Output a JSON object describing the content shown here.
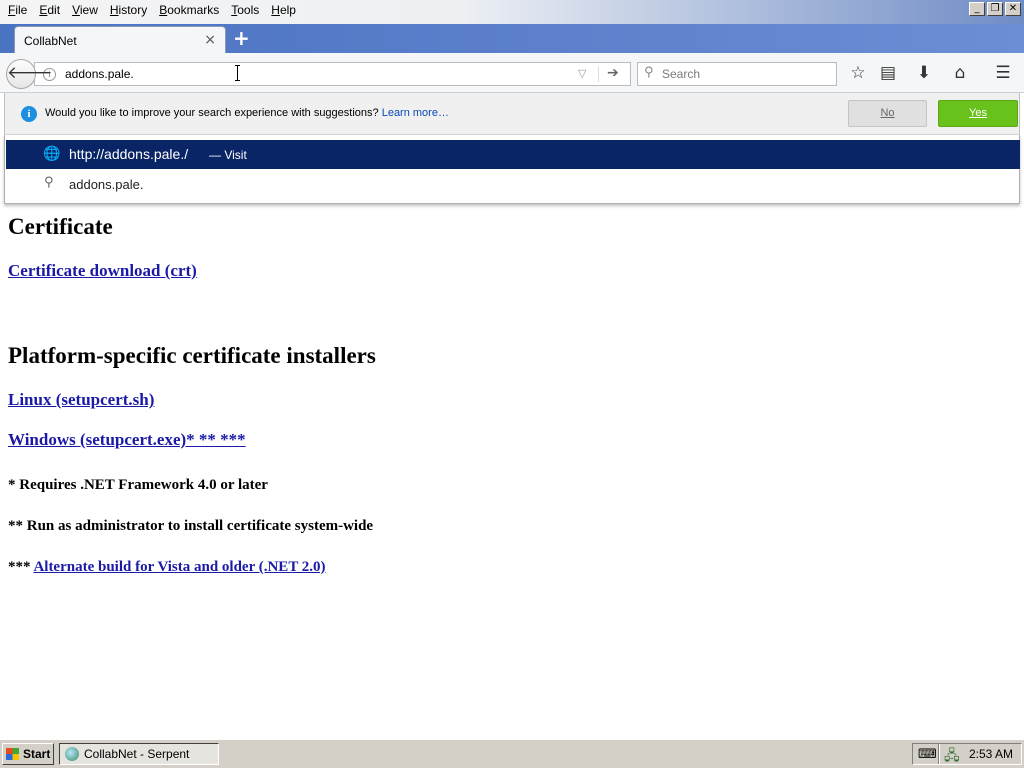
{
  "menubar": {
    "items": [
      {
        "mnemonic": "F",
        "rest": "ile"
      },
      {
        "mnemonic": "E",
        "rest": "dit"
      },
      {
        "mnemonic": "V",
        "rest": "iew"
      },
      {
        "mnemonic": "H",
        "rest": "istory"
      },
      {
        "mnemonic": "B",
        "rest": "ookmarks"
      },
      {
        "mnemonic": "T",
        "rest": "ools"
      },
      {
        "mnemonic": "H",
        "rest": "elp"
      }
    ]
  },
  "window_controls": {
    "minimize": "_",
    "maximize": "❐",
    "close": "✕"
  },
  "tab": {
    "title": "CollabNet",
    "close": "×",
    "new_tab": "+"
  },
  "navbar": {
    "url_value": "addons.pale.",
    "search_placeholder": "Search",
    "info_icon": "i"
  },
  "notification": {
    "message": "Would you like to improve your search experience with suggestions? ",
    "link": "Learn more…",
    "no_label": "No",
    "yes_label": "Yes"
  },
  "autocomplete": {
    "visit_url_prefix": "http://",
    "visit_url_host": "addons.pale./",
    "visit_action": "— Visit",
    "search_text": "addons.pale."
  },
  "page": {
    "heading1": "Certificate",
    "crt_link": "Certificate download (crt)",
    "heading2": "Platform-specific certificate installers",
    "linux_link": "Linux (setupcert.sh)",
    "windows_link": "Windows (setupcert.exe)* ** ***",
    "note1": "* Requires .NET Framework 4.0 or later",
    "note2": "** Run as administrator to install certificate system-wide",
    "note3_prefix": "*** ",
    "note3_link": "Alternate build for Vista and older (.NET 2.0)"
  },
  "taskbar": {
    "start_label": "Start",
    "task_label": "CollabNet - Serpent",
    "clock": "2:53 AM"
  }
}
